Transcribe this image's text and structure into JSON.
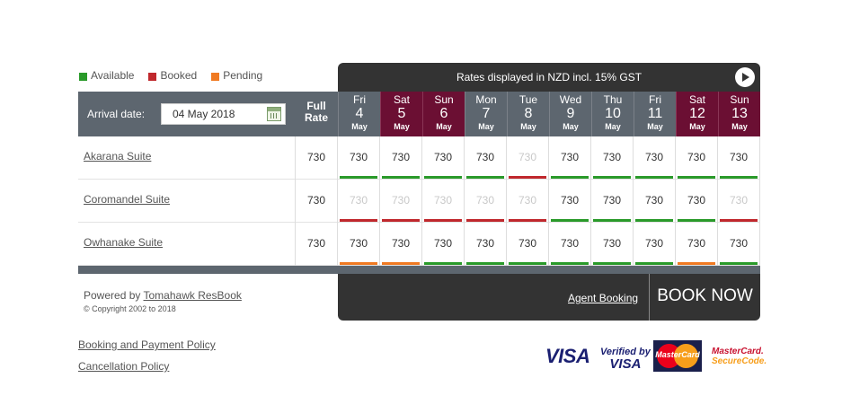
{
  "legend": [
    {
      "label": "Available",
      "color": "#2a9a2a"
    },
    {
      "label": "Booked",
      "color": "#c0282d"
    },
    {
      "label": "Pending",
      "color": "#f07a22"
    }
  ],
  "rates_banner": "Rates displayed in NZD incl. 15% GST",
  "arrival": {
    "label": "Arrival date:",
    "value": "04 May 2018"
  },
  "full_rate_header": [
    "Full",
    "Rate"
  ],
  "days": [
    {
      "name": "Fri",
      "num": "4",
      "month": "May",
      "weekend": false
    },
    {
      "name": "Sat",
      "num": "5",
      "month": "May",
      "weekend": true
    },
    {
      "name": "Sun",
      "num": "6",
      "month": "May",
      "weekend": true
    },
    {
      "name": "Mon",
      "num": "7",
      "month": "May",
      "weekend": false
    },
    {
      "name": "Tue",
      "num": "8",
      "month": "May",
      "weekend": false
    },
    {
      "name": "Wed",
      "num": "9",
      "month": "May",
      "weekend": false
    },
    {
      "name": "Thu",
      "num": "10",
      "month": "May",
      "weekend": false
    },
    {
      "name": "Fri",
      "num": "11",
      "month": "May",
      "weekend": false
    },
    {
      "name": "Sat",
      "num": "12",
      "month": "May",
      "weekend": true
    },
    {
      "name": "Sun",
      "num": "13",
      "month": "May",
      "weekend": true
    }
  ],
  "status_colors": {
    "available": "#2a9a2a",
    "booked": "#c0282d",
    "pending": "#f07a22"
  },
  "rooms": [
    {
      "name": "Akarana Suite",
      "full_rate": "730",
      "rates": [
        "730",
        "730",
        "730",
        "730",
        "730",
        "730",
        "730",
        "730",
        "730",
        "730"
      ],
      "status": [
        "available",
        "available",
        "available",
        "available",
        "booked",
        "available",
        "available",
        "available",
        "available",
        "available"
      ]
    },
    {
      "name": "Coromandel Suite",
      "full_rate": "730",
      "rates": [
        "730",
        "730",
        "730",
        "730",
        "730",
        "730",
        "730",
        "730",
        "730",
        "730"
      ],
      "status": [
        "booked",
        "booked",
        "booked",
        "booked",
        "booked",
        "available",
        "available",
        "available",
        "available",
        "booked"
      ]
    },
    {
      "name": "Owhanake Suite",
      "full_rate": "730",
      "rates": [
        "730",
        "730",
        "730",
        "730",
        "730",
        "730",
        "730",
        "730",
        "730",
        "730"
      ],
      "status": [
        "pending",
        "pending",
        "available",
        "available",
        "available",
        "available",
        "available",
        "available",
        "pending",
        "available"
      ]
    }
  ],
  "footer": {
    "powered_by": "Powered by",
    "powered_link": "Tomahawk ResBook",
    "copyright": "© Copyright 2002 to 2018",
    "agent_booking": "Agent Booking",
    "book_now": "BOOK NOW"
  },
  "policies": [
    "Booking and Payment Policy",
    "Cancellation Policy"
  ],
  "payment_logos": {
    "visa": "VISA",
    "verified_top": "Verified by",
    "verified_bottom": "VISA",
    "mastercard": "MasterCard",
    "securecode_top": "MasterCard.",
    "securecode_bottom": "SecureCode."
  }
}
